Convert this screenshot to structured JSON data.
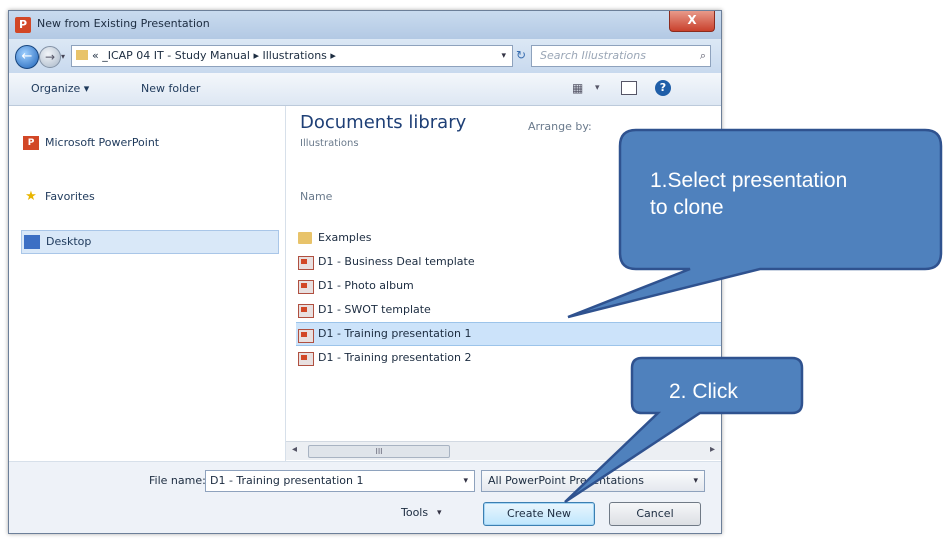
{
  "window": {
    "title": "New from Existing Presentation",
    "app_icon_letter": "P",
    "close_symbol": "X"
  },
  "nav": {
    "back_symbol": "←",
    "forward_symbol": "→",
    "history_symbol": "▾",
    "breadcrumb": "«  _ICAP 04 IT - Study Manual  ▸  Illustrations  ▸",
    "address_dropdown": "▾",
    "refresh_symbol": "↻",
    "search_placeholder": "Search Illustrations",
    "search_symbol": "⌕"
  },
  "toolbar": {
    "organize_label": "Organize ▾",
    "new_folder_label": "New folder",
    "view_symbol": "▦",
    "view_dropdown": "▾",
    "help_symbol": "?"
  },
  "sidebar": {
    "items": [
      {
        "label": "Microsoft PowerPoint",
        "icon": "powerpoint-icon"
      },
      {
        "label": "Favorites",
        "icon": "star-icon"
      },
      {
        "label": "Desktop",
        "icon": "desktop-icon"
      }
    ],
    "pp_icon_text": "P",
    "star_symbol": "★"
  },
  "library": {
    "title": "Documents library",
    "subtitle": "Illustrations",
    "arrange_by": "Arrange by:",
    "name_column": "Name"
  },
  "files": [
    {
      "name": "Examples",
      "type": "folder"
    },
    {
      "name": "D1 - Business Deal template",
      "type": "ppt"
    },
    {
      "name": "D1 - Photo album",
      "type": "ppt"
    },
    {
      "name": "D1 - SWOT template",
      "type": "ppt"
    },
    {
      "name": "D1 - Training presentation 1",
      "type": "ppt",
      "selected": true
    },
    {
      "name": "D1 - Training presentation 2",
      "type": "ppt"
    }
  ],
  "scroll": {
    "left_symbol": "◂",
    "right_symbol": "▸",
    "thumb_grip": "III"
  },
  "footer": {
    "file_name_label": "File name:",
    "file_name_value": "D1 - Training presentation 1",
    "file_name_dropdown": "▾",
    "file_type": "All PowerPoint Presentations",
    "file_type_dropdown": "▾",
    "tools_label": "Tools",
    "tools_dropdown": "▾",
    "create_label": "Create New",
    "cancel_label": "Cancel"
  },
  "callouts": {
    "select": {
      "line1": "1.Select  presentation",
      "line2": "to clone"
    },
    "click": {
      "text": "2. Click"
    }
  },
  "colors": {
    "callout_fill": "#4f81bd",
    "callout_border": "#2f528f",
    "selection": "#cce3fa"
  }
}
